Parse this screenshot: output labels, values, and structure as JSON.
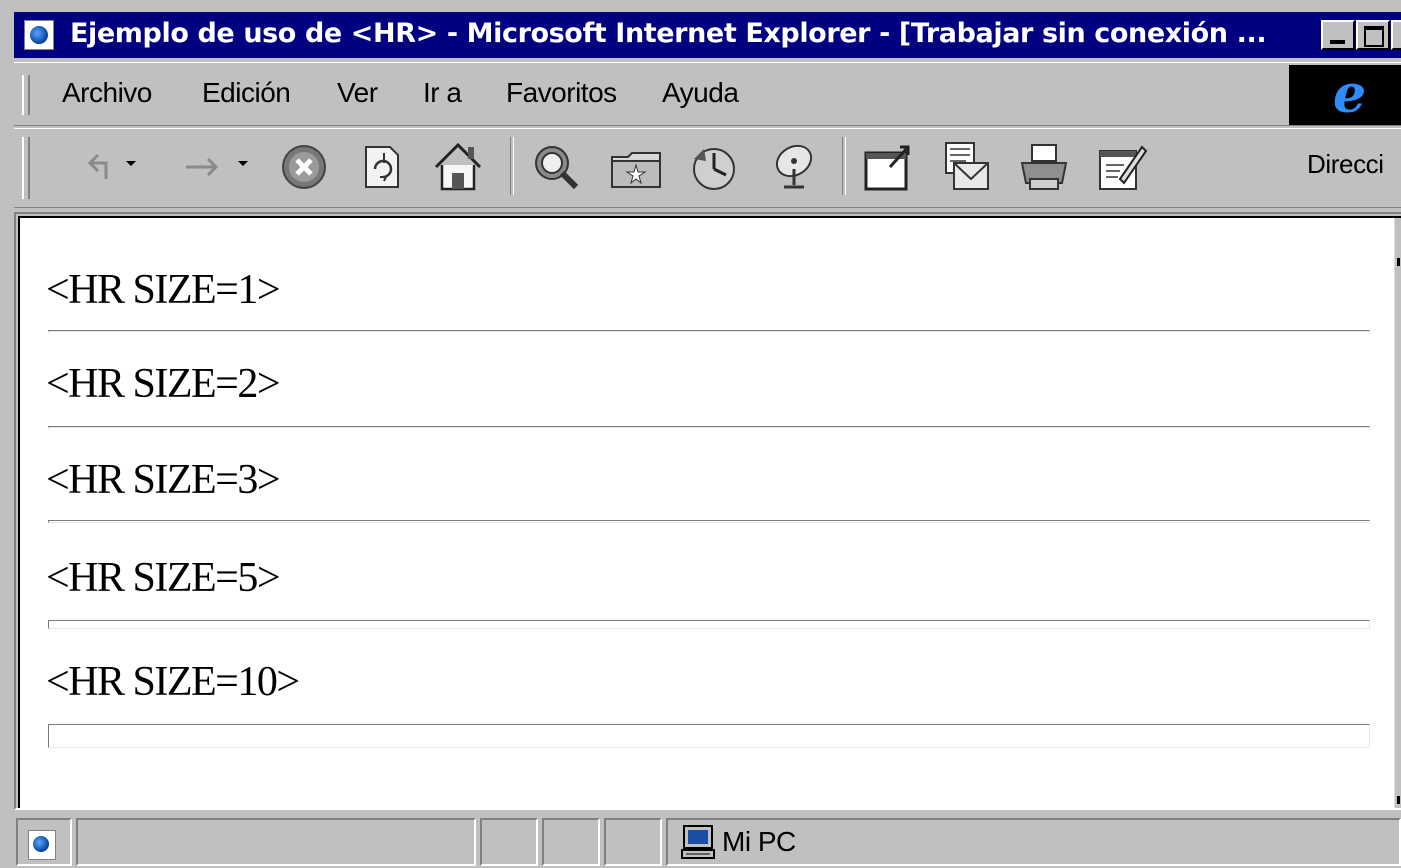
{
  "window": {
    "title": "Ejemplo de uso de <HR> - Microsoft Internet Explorer - [Trabajar sin conexión ..."
  },
  "menu": {
    "items": [
      "Archivo",
      "Edición",
      "Ver",
      "Ir a",
      "Favoritos",
      "Ayuda"
    ]
  },
  "toolbar": {
    "buttons": [
      "back-icon",
      "forward-icon",
      "stop-icon",
      "refresh-icon",
      "home-icon",
      "search-icon",
      "favorites-icon",
      "history-icon",
      "channels-icon",
      "fullscreen-icon",
      "mail-icon",
      "print-icon",
      "edit-icon"
    ],
    "address_label": "Direcci"
  },
  "content": {
    "rules": [
      {
        "label": "<HR SIZE=1>",
        "size": 1
      },
      {
        "label": "<HR SIZE=2>",
        "size": 2
      },
      {
        "label": "<HR SIZE=3>",
        "size": 3
      },
      {
        "label": "<HR SIZE=5>",
        "size": 5
      },
      {
        "label": "<HR SIZE=10>",
        "size": 10
      }
    ]
  },
  "status": {
    "zone": "Mi PC"
  },
  "colors": {
    "titlebar": "#000080",
    "chrome": "#c0c0c0",
    "page": "#ffffff",
    "ie_logo": "#2f8cff"
  }
}
